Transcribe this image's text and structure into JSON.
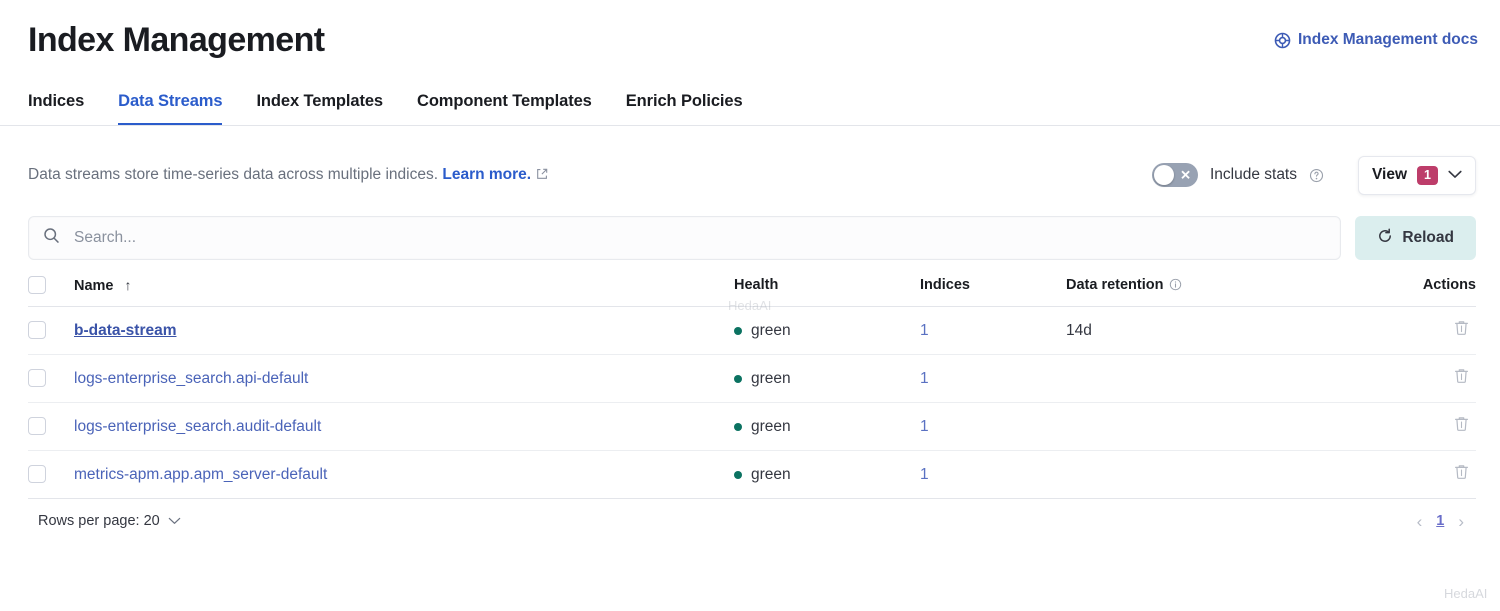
{
  "header": {
    "title": "Index Management",
    "docs_link": "Index Management docs",
    "docs_icon": "help-ring-icon"
  },
  "tabs": [
    {
      "label": "Indices",
      "active": false
    },
    {
      "label": "Data Streams",
      "active": true
    },
    {
      "label": "Index Templates",
      "active": false
    },
    {
      "label": "Component Templates",
      "active": false
    },
    {
      "label": "Enrich Policies",
      "active": false
    }
  ],
  "description": {
    "text": "Data streams store time-series data across multiple indices.",
    "link": "Learn more.",
    "external_icon": "external-link-icon"
  },
  "controls": {
    "include_stats_label": "Include stats",
    "include_stats_on": false,
    "toggle_mark": "✕",
    "help_icon": "question-circle-icon",
    "view_label": "View",
    "view_badge": "1",
    "view_chevron": "⌄"
  },
  "search": {
    "placeholder": "Search...",
    "value": "",
    "icon": "search-icon"
  },
  "reload": {
    "label": "Reload",
    "icon": "refresh-icon"
  },
  "table": {
    "columns": [
      {
        "key": "name",
        "label": "Name",
        "sorted": true,
        "sort_arrow": "↑"
      },
      {
        "key": "health",
        "label": "Health"
      },
      {
        "key": "indices",
        "label": "Indices"
      },
      {
        "key": "retention",
        "label": "Data retention",
        "info_icon": "info-circle-icon"
      },
      {
        "key": "actions",
        "label": "Actions"
      }
    ],
    "rows": [
      {
        "name": "b-data-stream",
        "health": "green",
        "indices": "1",
        "retention": "14d",
        "hovered": true
      },
      {
        "name": "logs-enterprise_search.api-default",
        "health": "green",
        "indices": "1",
        "retention": "",
        "hovered": false
      },
      {
        "name": "logs-enterprise_search.audit-default",
        "health": "green",
        "indices": "1",
        "retention": "",
        "hovered": false
      },
      {
        "name": "metrics-apm.app.apm_server-default",
        "health": "green",
        "indices": "1",
        "retention": "",
        "hovered": false
      }
    ],
    "row_action_icon": "trash-icon"
  },
  "footer": {
    "rows_per_page_label": "Rows per page: 20",
    "rows_per_page_chevron": "⌄",
    "prev_arrow": "‹",
    "next_arrow": "›",
    "current_page": "1"
  },
  "watermark": {
    "middle": "HedaAI",
    "bottom_right": "HedaAI"
  },
  "colors": {
    "accent_blue": "#2b5ccb",
    "link_blue": "#4a63b8",
    "health_green": "#0b7261",
    "badge_pink": "#bd3d6a",
    "reload_bg": "#dbeeee",
    "toggle_off": "#98a2b3"
  }
}
